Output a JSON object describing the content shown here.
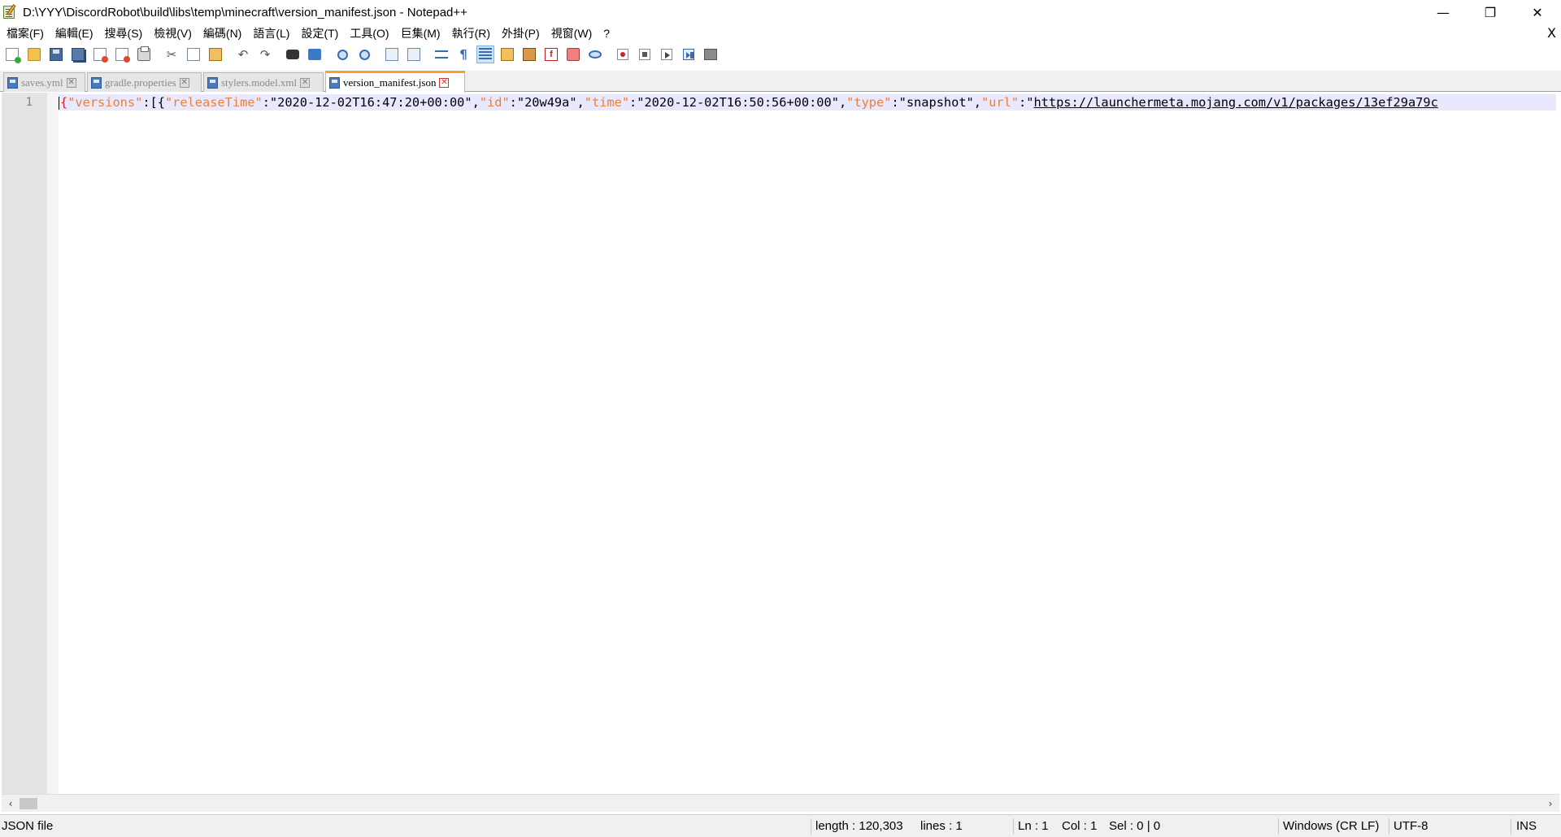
{
  "window": {
    "title": "D:\\YYY\\DiscordRobot\\build\\libs\\temp\\minecraft\\version_manifest.json - Notepad++",
    "minimize": "—",
    "restore": "❐",
    "close": "✕",
    "doc_close": "X"
  },
  "menu": [
    "檔案(F)",
    "編輯(E)",
    "搜尋(S)",
    "檢視(V)",
    "編碼(N)",
    "語言(L)",
    "設定(T)",
    "工具(O)",
    "巨集(M)",
    "執行(R)",
    "外掛(P)",
    "視窗(W)",
    "?"
  ],
  "toolbar": {
    "icons": [
      "new-file",
      "open-file",
      "save",
      "save-all",
      "close",
      "close-all",
      "print",
      "cut",
      "copy",
      "paste",
      "undo",
      "redo",
      "find",
      "replace",
      "zoom-in",
      "zoom-out",
      "sync-vertical",
      "sync-horizontal",
      "word-wrap",
      "show-all-chars",
      "indent-guide",
      "user-language",
      "document-map",
      "function-list",
      "folder-as-workspace",
      "monitoring",
      "record-macro",
      "stop-recording",
      "playback-macro",
      "run-macro-multiple",
      "save-macro"
    ],
    "active": "indent-guide"
  },
  "tabs": [
    {
      "label": "saves.yml",
      "active": false
    },
    {
      "label": "gradle.properties",
      "active": false
    },
    {
      "label": "stylers.model.xml",
      "active": false
    },
    {
      "label": "version_manifest.json",
      "active": true
    }
  ],
  "editor": {
    "line_number": "1",
    "tokens": {
      "open": "{",
      "k_versions": "\"versions\"",
      "p1": ":[{",
      "k_releaseTime": "\"releaseTime\"",
      "c1": ":",
      "v_releaseTime": "\"2020-12-02T16:47:20+00:00\"",
      "s1": ",",
      "k_id": "\"id\"",
      "c2": ":",
      "v_id": "\"20w49a\"",
      "s2": ",",
      "k_time": "\"time\"",
      "c3": ":",
      "v_time": "\"2020-12-02T16:50:56+00:00\"",
      "s3": ",",
      "k_type": "\"type\"",
      "c4": ":",
      "v_type": "\"snapshot\"",
      "s4": ",",
      "k_url": "\"url\"",
      "c5": ":",
      "q_url": "\"",
      "v_url": "https://launchermeta.mojang.com/v1/packages/13ef29a79c"
    },
    "colors": {
      "key": "#f08030",
      "brace": "#d02020",
      "text": "#000000",
      "current_line": "#e8e8ff"
    }
  },
  "scrollbar": {
    "left": "‹",
    "right": "›"
  },
  "status": {
    "file_type": "JSON file",
    "length": "length : 120,303",
    "lines": "lines : 1",
    "ln": "Ln : 1",
    "col": "Col : 1",
    "sel": "Sel : 0 | 0",
    "eol": "Windows (CR LF)",
    "encoding": "UTF-8",
    "mode": "INS"
  }
}
